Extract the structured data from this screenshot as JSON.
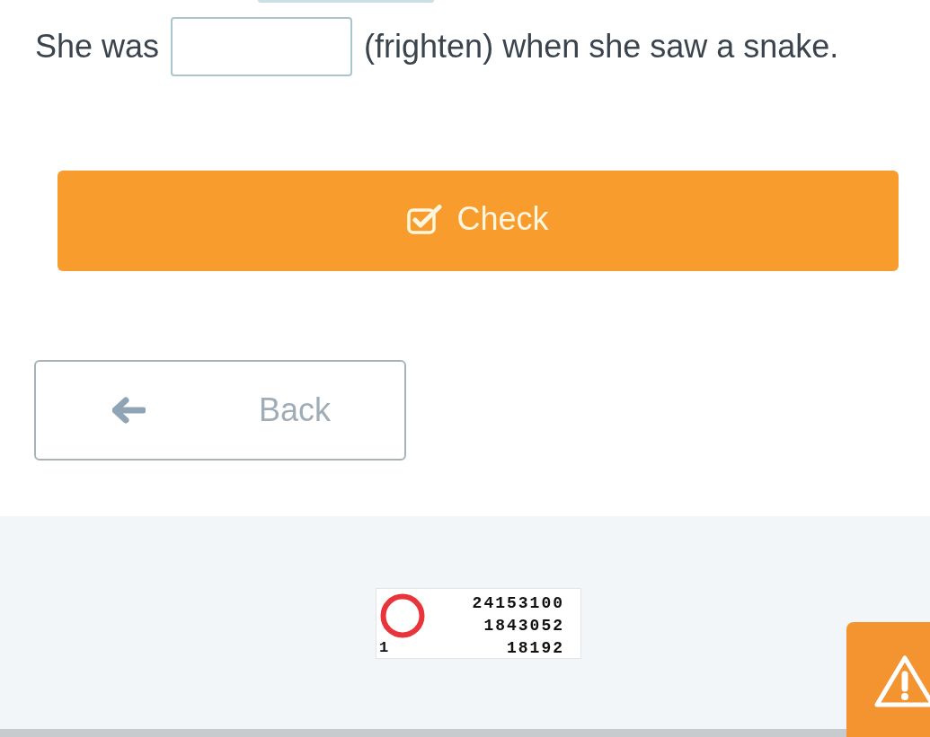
{
  "question": {
    "text_before": "She was",
    "text_after": "(frighten) when she saw a snake."
  },
  "check_button": {
    "label": "Check"
  },
  "back_button": {
    "label": "Back"
  },
  "counter_widget": {
    "lines": [
      "24153100",
      "1843052",
      "18192"
    ],
    "corner_number": "1"
  }
}
